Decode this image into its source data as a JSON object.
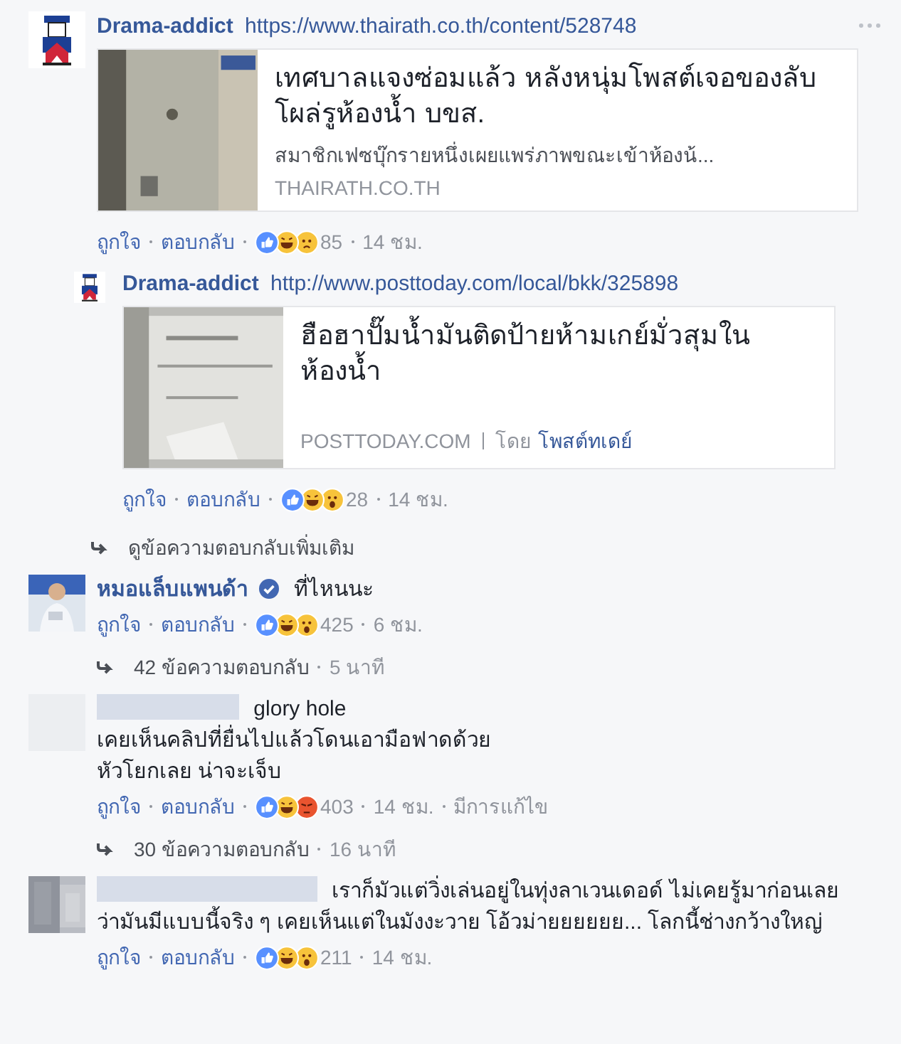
{
  "comments": [
    {
      "avatar": {
        "kind": "mascot"
      },
      "author": "Drama-addict",
      "url": "https://www.thairath.co.th/content/528748",
      "menu": true,
      "card": {
        "kind": "large",
        "title": "เทศบาลแจงซ่อมแล้ว หลังหนุ่มโพสต์เจอของลับโผล่รูห้องน้ำ บขส.",
        "description": "สมาชิกเฟซบุ๊กรายหนึ่งเผยแพร่ภาพขณะเข้าห้องน้...",
        "domain": "THAIRATH.CO.TH"
      },
      "actions": {
        "like": "ถูกใจ",
        "reply": "ตอบกลับ",
        "reactions": [
          {
            "kind": "like"
          },
          {
            "kind": "haha"
          },
          {
            "kind": "sad"
          }
        ],
        "count": "85",
        "time": "14 ชม."
      },
      "replies": [
        {
          "avatar": {
            "kind": "mascot"
          },
          "author": "Drama-addict",
          "url": "http://www.posttoday.com/local/bkk/325898",
          "card": {
            "kind": "small",
            "title": "ฮือฮาปั๊มน้ำมันติดป้ายห้ามเกย์มั่วสุมในห้องน้ำ",
            "domain": "POSTTODAY.COM",
            "by_label": "โดย",
            "by_name": "โพสต์ทเดย์"
          },
          "actions": {
            "like": "ถูกใจ",
            "reply": "ตอบกลับ",
            "reactions": [
              {
                "kind": "like"
              },
              {
                "kind": "haha"
              },
              {
                "kind": "wow"
              }
            ],
            "count": "28",
            "time": "14 ชม."
          }
        }
      ],
      "more_replies": "ดูข้อความตอบกลับเพิ่มเติม"
    },
    {
      "author": "หมอแล็บแพนด้า",
      "verified": true,
      "text": "ที่ไหนนะ",
      "actions": {
        "like": "ถูกใจ",
        "reply": "ตอบกลับ",
        "reactions": [
          {
            "kind": "like"
          },
          {
            "kind": "haha"
          },
          {
            "kind": "wow"
          }
        ],
        "count": "425",
        "time": "6 ชม."
      },
      "reply_count": {
        "label": "42 ข้อความตอบกลับ",
        "time": "5 นาที"
      }
    },
    {
      "avatar": {
        "kind": "blank"
      },
      "author_blurred": true,
      "text": "glory hole\nเคยเห็นคลิปที่ยื่นไปแล้วโดนเอามือฟาดด้วย\nหัวโยกเลย น่าจะเจ็บ",
      "actions": {
        "like": "ถูกใจ",
        "reply": "ตอบกลับ",
        "reactions": [
          {
            "kind": "like"
          },
          {
            "kind": "haha"
          },
          {
            "kind": "angry"
          }
        ],
        "count": "403",
        "time": "14 ชม.",
        "edited": "มีการแก้ไข"
      },
      "reply_count": {
        "label": "30 ข้อความตอบกลับ",
        "time": "16 นาที"
      }
    },
    {
      "author_blurred": true,
      "text": "เราก็มัวแต่วิ่งเล่นอยู่ในทุ่งลาเวนเดอด์ ไม่เคยรู้มาก่อนเลยว่ามันมีแบบนี้จริง ๆ เคยเห็นแต่ในมังงะวาย โอ้วม่ายยยยยย... โลกนี้ช่างกว้างใหญ่",
      "actions": {
        "like": "ถูกใจ",
        "reply": "ตอบกลับ",
        "reactions": [
          {
            "kind": "like"
          },
          {
            "kind": "haha"
          },
          {
            "kind": "wow"
          }
        ],
        "count": "211",
        "time": "14 ชม."
      }
    }
  ]
}
